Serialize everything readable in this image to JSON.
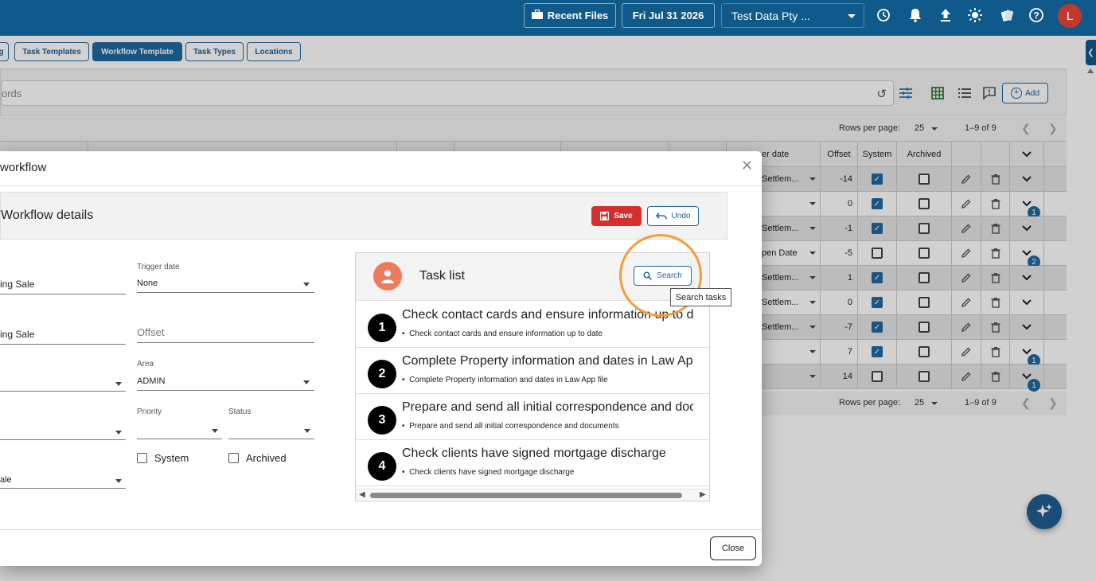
{
  "topbar": {
    "recent_files": "Recent Files",
    "date": "Fri Jul 31 2026",
    "company": "Test Data Pty ...",
    "user_initial": "L"
  },
  "tabs": [
    {
      "label": "g"
    },
    {
      "label": "Task Templates"
    },
    {
      "label": "Workflow Template",
      "active": true
    },
    {
      "label": "Task Types"
    },
    {
      "label": "Locations"
    }
  ],
  "search": {
    "placeholder": "ords",
    "add_label": "Add"
  },
  "pager": {
    "rows_per_page_label": "Rows per page:",
    "rows_per_page": "25",
    "range": "1–9 of 9"
  },
  "table": {
    "headers": {
      "trigger_date": "er date",
      "offset": "Offset",
      "system": "System",
      "archived": "Archived"
    },
    "rows": [
      {
        "trigger": "Settlem...",
        "offset": "-14",
        "system": true,
        "archived": false,
        "badge": ""
      },
      {
        "trigger": "",
        "offset": "0",
        "system": true,
        "archived": false,
        "badge": "1"
      },
      {
        "trigger": "Settlem...",
        "offset": "-1",
        "system": true,
        "archived": false,
        "badge": ""
      },
      {
        "trigger": "pen Date",
        "offset": "-5",
        "system": false,
        "archived": false,
        "badge": "2"
      },
      {
        "trigger": "Settlem...",
        "offset": "1",
        "system": true,
        "archived": false,
        "badge": ""
      },
      {
        "trigger": "Settlem...",
        "offset": "0",
        "system": true,
        "archived": false,
        "badge": ""
      },
      {
        "trigger": "Settlem...",
        "offset": "-7",
        "system": true,
        "archived": false,
        "badge": ""
      },
      {
        "trigger": "",
        "offset": "7",
        "system": true,
        "archived": false,
        "badge": "1"
      },
      {
        "trigger": "",
        "offset": "14",
        "system": false,
        "archived": false,
        "badge": "1"
      }
    ]
  },
  "modal": {
    "title": "workflow",
    "details_title": "Workflow details",
    "save_label": "Save",
    "undo_label": "Undo",
    "close_label": "Close",
    "fields": {
      "name_value": "ing Sale",
      "description_value": "ing Sale",
      "trigger_label": "Trigger date",
      "trigger_value": "None",
      "offset_placeholder": "Offset",
      "area_label": "Area",
      "area_value": "ADMIN",
      "priority_label": "Priority",
      "status_label": "Status",
      "system_label": "System",
      "archived_label": "Archived",
      "bottom_value": "ale"
    },
    "task_list": {
      "title": "Task list",
      "search_label": "Search",
      "tooltip": "Search tasks",
      "tasks": [
        {
          "num": "1",
          "title": "Check contact cards and ensure information up to date",
          "sub": "Check contact cards and ensure information up to date"
        },
        {
          "num": "2",
          "title": "Complete Property information and dates in Law App file",
          "sub": "Complete Property information and dates in Law App file"
        },
        {
          "num": "3",
          "title": "Prepare and send all initial correspondence and documents",
          "sub": "Prepare and send all initial correspondence and documents"
        },
        {
          "num": "4",
          "title": "Check clients have signed mortgage discharge",
          "sub": "Check clients have signed mortgage discharge"
        }
      ]
    }
  },
  "colors": {
    "brand": "#0f5a8a",
    "accent": "#1f6aa0",
    "save": "#d32f2f",
    "highlight": "#f39c3a"
  }
}
